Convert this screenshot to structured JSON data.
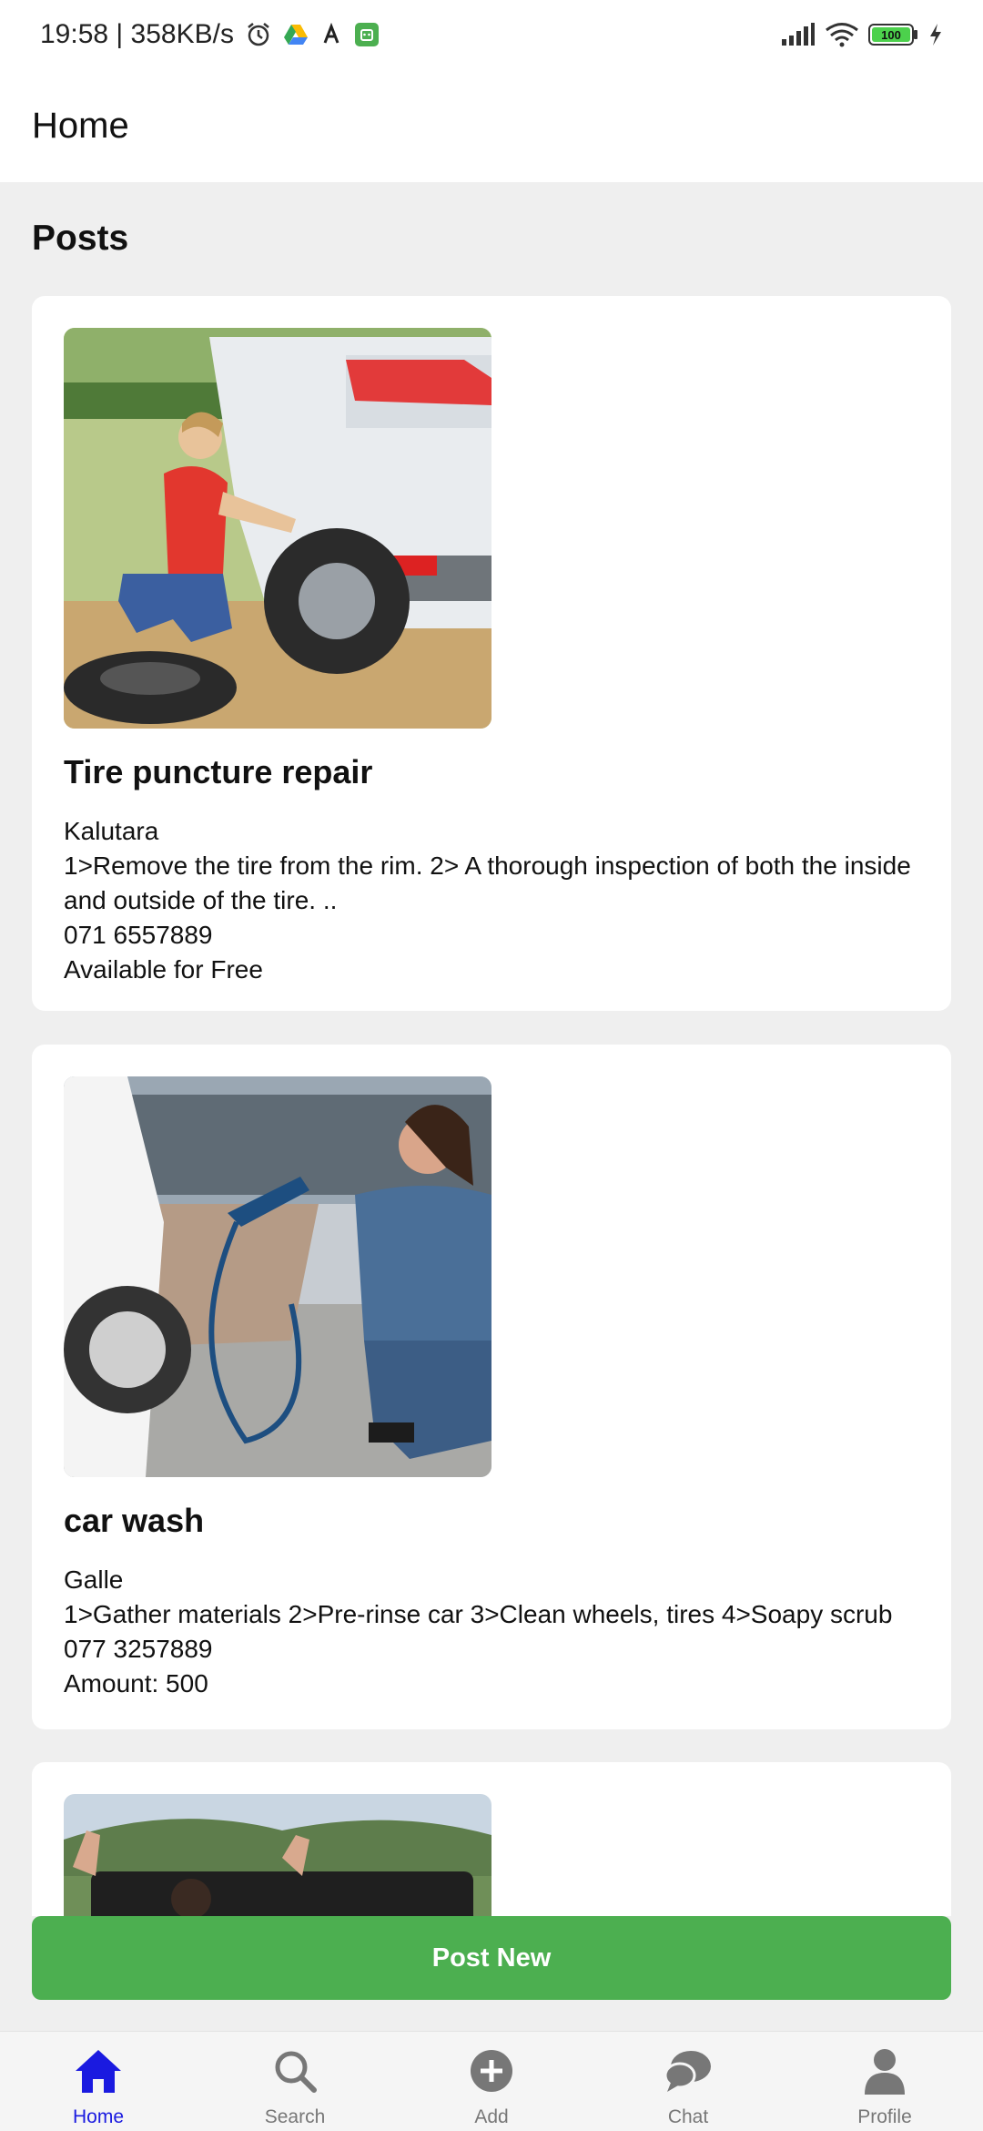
{
  "status_bar": {
    "time_speed": "19:58 | 358KB/s",
    "battery": "100"
  },
  "app_bar": {
    "title": "Home"
  },
  "posts_section": {
    "title": "Posts"
  },
  "posts": [
    {
      "title": "Tire puncture repair",
      "location": "Kalutara",
      "description": "1>Remove the tire from the rim. 2> A thorough inspection of both the inside and outside of the tire. ..",
      "phone": "071 6557889",
      "price": "Available for Free"
    },
    {
      "title": "car wash",
      "location": "Galle",
      "description": "1>Gather materials 2>Pre-rinse car 3>Clean wheels, tires 4>Soapy scrub",
      "phone": "077 3257889",
      "price": "Amount: 500"
    }
  ],
  "post_new": {
    "label": "Post New"
  },
  "bottom_nav": {
    "items": [
      {
        "label": "Home",
        "icon": "home-icon"
      },
      {
        "label": "Search",
        "icon": "search-icon"
      },
      {
        "label": "Add",
        "icon": "add-icon"
      },
      {
        "label": "Chat",
        "icon": "chat-icon"
      },
      {
        "label": "Profile",
        "icon": "profile-icon"
      }
    ]
  },
  "colors": {
    "accent_green": "#4caf50",
    "nav_active": "#1a1ae0",
    "background": "#efefef"
  }
}
